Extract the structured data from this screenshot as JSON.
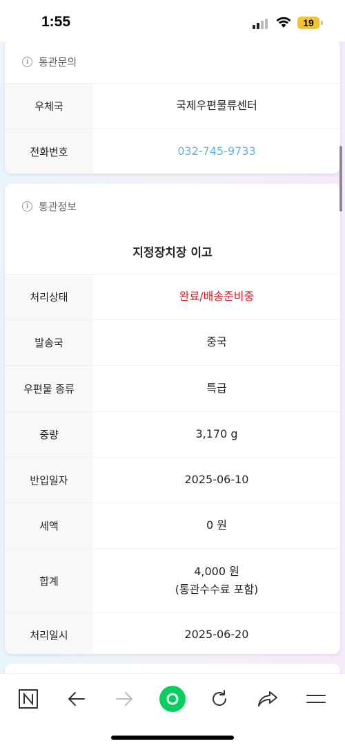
{
  "status_bar": {
    "time": "1:55",
    "battery": "19"
  },
  "contact_card": {
    "title": "통관문의",
    "rows": [
      {
        "label": "우체국",
        "value": "국제우편물류센터"
      },
      {
        "label": "전화번호",
        "value": "032-745-9733"
      }
    ]
  },
  "customs_card": {
    "title": "통관정보",
    "subtitle": "지정장치장 이고",
    "rows": [
      {
        "label": "처리상태",
        "value": "완료/배송준비중"
      },
      {
        "label": "발송국",
        "value": "중국"
      },
      {
        "label": "우편물 종류",
        "value": "특급"
      },
      {
        "label": "중량",
        "value": "3,170 g"
      },
      {
        "label": "반입일자",
        "value": "2025-06-10"
      },
      {
        "label": "세액",
        "value": "0 원"
      },
      {
        "label": "합계",
        "value": "4,000 원",
        "value_line2": "(통관수수료 포함)"
      },
      {
        "label": "처리일시",
        "value": "2025-06-20"
      }
    ]
  },
  "bottom_nav": {
    "icons": [
      "naver-home-icon",
      "back-arrow-icon",
      "forward-arrow-icon",
      "green-dot-icon",
      "refresh-icon",
      "share-icon",
      "menu-icon"
    ]
  },
  "colors": {
    "link": "#5bb5e0",
    "status_red": "#e0161e",
    "accent_green": "#03cf5d"
  }
}
